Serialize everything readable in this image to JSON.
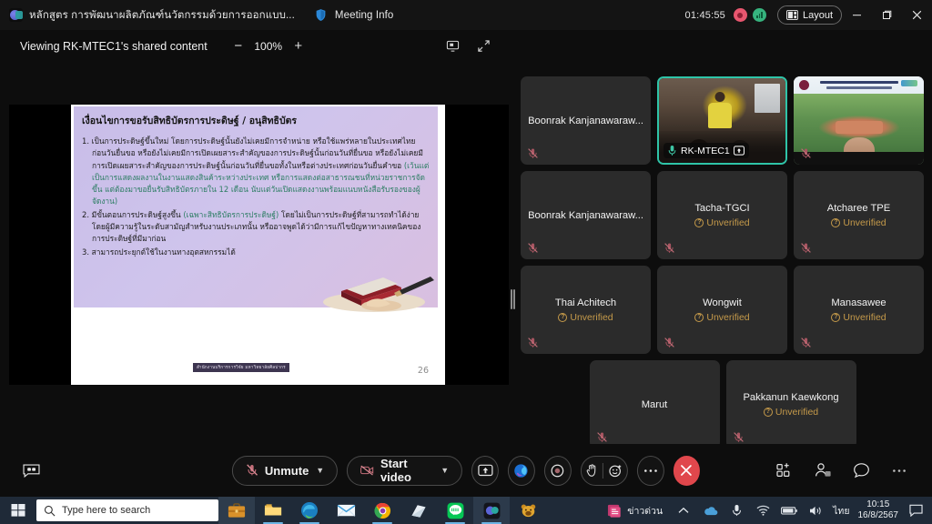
{
  "titlebar": {
    "tab_title": "หลักสูตร การพัฒนาผลิตภัณฑ์นวัตกรรมด้วยการออกแบบ...",
    "meeting_info_label": "Meeting Info",
    "timer": "01:45:55",
    "layout_label": "Layout",
    "minimize_label": "—",
    "restore_label": "❐",
    "close_label": "✕",
    "teams_icon": "teams-logo-icon",
    "shield_icon": "shield-icon",
    "record_icon": "recording-indicator-icon",
    "network_icon": "network-quality-icon"
  },
  "sharebar": {
    "viewing_label": "Viewing RK-MTEC1's shared content",
    "zoom_out_label": "−",
    "zoom_value": "100%",
    "zoom_in_label": "+",
    "pop_out_icon": "pop-out-screen-icon",
    "fullscreen_icon": "fullscreen-icon"
  },
  "slide": {
    "title": "เงื่อนไขการขอรับสิทธิบัตรการประดิษฐ์ / อนุสิทธิบัตร",
    "items": [
      {
        "num": "1.",
        "text": "เป็นการประดิษฐ์ขึ้นใหม่  โดยการประดิษฐ์นั้นยังไม่เคยมีการจำหน่าย หรือใช้แพร่หลายในประเทศไทยก่อนวันยื่นขอ หรือยังไม่เคยมีการเปิดเผยสาระสำคัญของการประดิษฐ์นั้นก่อนวันที่ยื่นขอ หรือยังไม่เคยมีการเปิดเผยสาระสำคัญของการประดิษฐ์นั้นก่อนวันที่ยื่นขอทั้งในหรือต่างประเทศก่อนวันยื่นคำขอ ",
        "highlight": "(เว้นแต่เป็นการแสดงผลงานในงานแสดงสินค้าระหว่างประเทศ หรือการแสดงต่อสาธารณชนที่หน่วยราชการจัดขึ้น แต่ต้องมาขอยื่นรับสิทธิบัตรภายใน 12 เดือน นับแต่วันเปิดแสดงงานพร้อมแนบหนังสือรับรองของผู้จัดงาน)"
      },
      {
        "num": "2.",
        "text_pre": "มีขั้นตอนการประดิษฐ์สูงขึ้น ",
        "highlight": "(เฉพาะสิทธิบัตรการประดิษฐ์)",
        "text_post": " โดยไม่เป็นการประดิษฐ์ที่สามารถทำได้ง่ายโดยผู้มีความรู้ในระดับสามัญสำหรับงานประเภทนั้น หรืออาจพูดได้ว่ามีการแก้ไขปัญหาทางเทคนิคของการประดิษฐ์ที่มีมาก่อน"
      },
      {
        "num": "3.",
        "text": "สามารถประยุกต์ใช้ในงานทางอุตสหกรรมได้"
      }
    ],
    "footer_tag": "สำนักงานบริการการวิจัย มหาวิทยาลัยศิลปากร",
    "page_number": "26"
  },
  "participants": {
    "unverified_label": "Unverified",
    "rows": [
      [
        {
          "name": "Boonrak Kanjanawaraw...",
          "verified": true,
          "muted": true,
          "video": false
        },
        {
          "name": "RK-MTEC1",
          "verified": true,
          "muted": false,
          "video": true,
          "active": true,
          "sharing": true
        },
        {
          "name": "",
          "verified": true,
          "muted": true,
          "video": true
        }
      ],
      [
        {
          "name": "Boonrak Kanjanawaraw...",
          "verified": true,
          "muted": true,
          "video": false
        },
        {
          "name": "Tacha-TGCI",
          "verified": false,
          "muted": true,
          "video": false
        },
        {
          "name": "Atcharee TPE",
          "verified": false,
          "muted": true,
          "video": false
        }
      ],
      [
        {
          "name": "Thai Achitech",
          "verified": false,
          "muted": true,
          "video": false
        },
        {
          "name": "Wongwit",
          "verified": false,
          "muted": true,
          "video": false
        },
        {
          "name": "Manasawee",
          "verified": false,
          "muted": true,
          "video": false
        }
      ],
      [
        {
          "name": "Marut",
          "verified": true,
          "muted": true,
          "video": false
        },
        {
          "name": "Pakkanun Kaewkong",
          "verified": false,
          "muted": true,
          "video": false
        }
      ]
    ]
  },
  "actionbar": {
    "cc_icon": "closed-captions-icon",
    "unmute_label": "Unmute",
    "start_video_label": "Start video",
    "share_icon": "share-screen-icon",
    "copilot_icon": "copilot-icon",
    "record_icon": "record-icon",
    "raise_hand_icon": "raise-hand-icon",
    "reactions_icon": "reactions-icon",
    "more_icon": "more-options-icon",
    "leave_icon": "leave-call-icon",
    "apps_icon": "apps-grid-icon",
    "people_icon": "people-icon",
    "chat_icon": "chat-bubble-icon",
    "overflow_icon": "more-horizontal-icon"
  },
  "taskbar": {
    "start_icon": "windows-start-icon",
    "search_placeholder": "Type here to search",
    "briefcase_icon": "briefcase-icon",
    "apps": [
      {
        "icon": "file-explorer-icon",
        "open": true
      },
      {
        "icon": "microsoft-edge-icon",
        "open": true
      },
      {
        "icon": "mail-icon",
        "open": false
      },
      {
        "icon": "chrome-icon",
        "open": true
      },
      {
        "icon": "notes-icon",
        "open": false
      },
      {
        "icon": "line-icon",
        "open": true
      },
      {
        "icon": "teams-icon",
        "open": true,
        "active": true
      },
      {
        "icon": "bear-app-icon",
        "open": false
      }
    ],
    "tray": {
      "news_label": "ข่าวด่วน",
      "news_icon": "news-weather-icon",
      "chevron_icon": "show-hidden-icons-icon",
      "onedrive_icon": "onedrive-icon",
      "mic_icon": "microphone-icon",
      "wifi_icon": "wifi-icon",
      "battery_icon": "battery-icon",
      "volume_icon": "volume-icon",
      "language": "ไทย",
      "time": "10:15",
      "date": "16/8/2567",
      "notification_icon": "notification-center-icon"
    }
  }
}
